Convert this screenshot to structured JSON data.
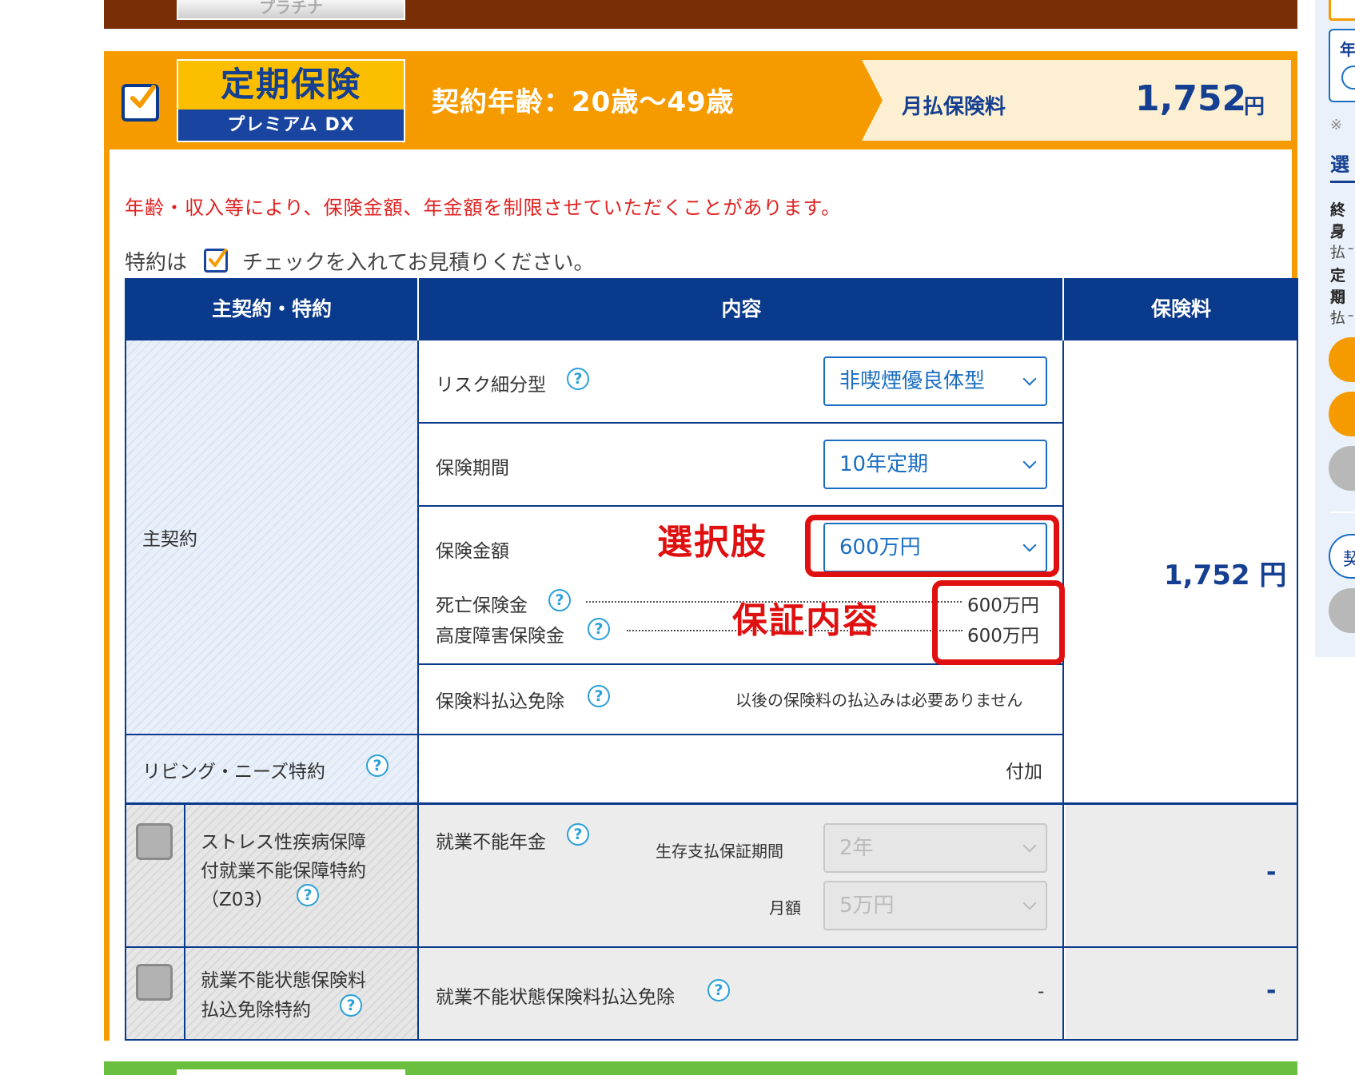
{
  "header": {
    "top_logo_text": "プラチナ",
    "plan_name": "定期保険",
    "plan_subname": "プレミアム DX",
    "age_range": "契約年齢：20歳～49歳",
    "premium_label": "月払保険料",
    "premium_value": "1,752",
    "premium_unit": "円"
  },
  "notice": "年齢・収入等により、保険金額、年金額を制限させていただくことがあります。",
  "instruction": {
    "prefix": "特約は",
    "suffix": "チェックを入れてお見積りください。"
  },
  "table": {
    "headers": [
      "主契約・特約",
      "内容",
      "保険料"
    ],
    "main_contract": {
      "label": "主契約",
      "risk_label": "リスク細分型",
      "risk_value": "非喫煙優良体型",
      "period_label": "保険期間",
      "period_value": "10年定期",
      "amount_label": "保険金額",
      "amount_value": "600万円",
      "death_label": "死亡保険金",
      "death_value": "600万円",
      "disability_label": "高度障害保険金",
      "disability_value": "600万円",
      "waiver_label": "保険料払込免除",
      "waiver_value": "以後の保険料の払込みは必要ありません",
      "premium": "1,752 円"
    },
    "living_needs": {
      "label": "リビング・ニーズ特約",
      "value": "付加"
    },
    "stress_rider": {
      "label_line1": "ストレス性疾病保障",
      "label_line2": "付就業不能保障特約",
      "label_line3": "（Z03）",
      "content_label": "就業不能年金",
      "guarantee_label": "生存支払保証期間",
      "guarantee_value": "2年",
      "monthly_label": "月額",
      "monthly_value": "5万円",
      "premium": "-"
    },
    "waiver_rider": {
      "label_line1": "就業不能状態保険料",
      "label_line2": "払込免除特約",
      "content_label": "就業不能状態保険料払込免除",
      "content_value": "-",
      "premium": "-"
    }
  },
  "annotations": {
    "choice": "選択肢",
    "coverage": "保証内容"
  },
  "side_panel": {
    "note_mark": "※",
    "snippets": [
      "年",
      "選",
      "終身",
      "月払",
      "定期",
      "月払",
      "契"
    ]
  },
  "colors": {
    "orange": "#f59b00",
    "navy": "#0a3a8c",
    "select_blue": "#1a6ec2",
    "annotation_red": "#e01010",
    "notice_red": "#e02020"
  }
}
